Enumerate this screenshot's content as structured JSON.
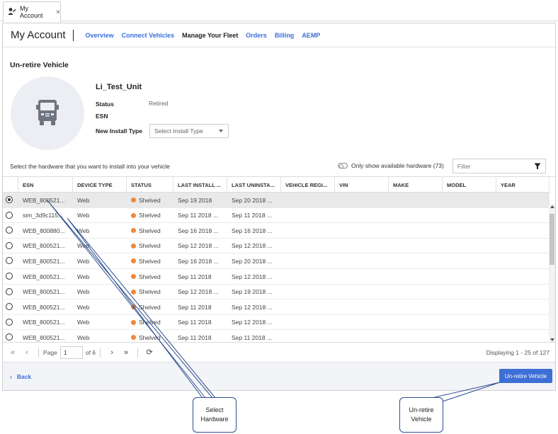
{
  "tab": {
    "label": "My Account"
  },
  "header": {
    "title": "My Account",
    "nav": [
      {
        "label": "Overview",
        "active": false
      },
      {
        "label": "Connect Vehicles",
        "active": false
      },
      {
        "label": "Manage Your Fleet",
        "active": true
      },
      {
        "label": "Orders",
        "active": false
      },
      {
        "label": "Billing",
        "active": false
      },
      {
        "label": "AEMP",
        "active": false
      }
    ]
  },
  "section": {
    "title": "Un-retire Vehicle"
  },
  "vehicle": {
    "name": "Li_Test_Unit",
    "status_label": "Status",
    "status_value": "Retired",
    "esn_label": "ESN",
    "install_type_label": "New Install Type",
    "install_type_placeholder": "Select Install Type"
  },
  "hardware": {
    "instruction": "Select the hardware that you want to install into your vehicle",
    "toggle_label": "Only show available hardware (73)",
    "filter_placeholder": "Filter",
    "columns": [
      "ESN",
      "DEVICE TYPE",
      "STATUS",
      "LAST INSTALL ...",
      "LAST UNINSTA...",
      "VEHICLE REGI...",
      "VIN",
      "MAKE",
      "MODEL",
      "YEAR"
    ],
    "rows": [
      {
        "esn": "WEB_800521...",
        "device": "Web",
        "status": "Shelved",
        "install": "Sep 19 2018",
        "uninstall": "Sep 20 2018 ...",
        "selected": true
      },
      {
        "esn": "sim_3d9c115...",
        "device": "Web",
        "status": "Shelved",
        "install": "Sep 11 2018 ...",
        "uninstall": "Sep 11 2018 ...",
        "selected": false
      },
      {
        "esn": "WEB_800880...",
        "device": "Web",
        "status": "Shelved",
        "install": "Sep 16 2018 ...",
        "uninstall": "Sep 16 2018 ...",
        "selected": false
      },
      {
        "esn": "WEB_800521...",
        "device": "Web",
        "status": "Shelved",
        "install": "Sep 12 2018 ...",
        "uninstall": "Sep 12 2018 ...",
        "selected": false
      },
      {
        "esn": "WEB_800521...",
        "device": "Web",
        "status": "Shelved",
        "install": "Sep 16 2018 ...",
        "uninstall": "Sep 20 2018 ...",
        "selected": false
      },
      {
        "esn": "WEB_800521...",
        "device": "Web",
        "status": "Shelved",
        "install": "Sep 11 2018",
        "uninstall": "Sep 12 2018 ...",
        "selected": false
      },
      {
        "esn": "WEB_800521...",
        "device": "Web",
        "status": "Shelved",
        "install": "Sep 12 2018 ...",
        "uninstall": "Sep 19 2018 ...",
        "selected": false
      },
      {
        "esn": "WEB_800521...",
        "device": "Web",
        "status": "Shelved",
        "install": "Sep 11 2018",
        "uninstall": "Sep 12 2018 ...",
        "selected": false
      },
      {
        "esn": "WEB_800521...",
        "device": "Web",
        "status": "Shelved",
        "install": "Sep 11 2018",
        "uninstall": "Sep 12 2018 ...",
        "selected": false
      },
      {
        "esn": "WEB_800521...",
        "device": "Web",
        "status": "Shelved",
        "install": "Sep 11 2018",
        "uninstall": "Sep 11 2018 ...",
        "selected": false
      }
    ]
  },
  "pager": {
    "page_label": "Page",
    "page_value": "1",
    "of_label": "of 6",
    "display_text": "Displaying 1 - 25 of 127"
  },
  "footer": {
    "back_label": "Back",
    "unretire_label": "Un-retire Vehicle"
  },
  "callouts": {
    "select_hardware": "Select Hardware",
    "unretire_vehicle": "Un-retire Vehicle"
  },
  "colors": {
    "accent": "#3a6fd8",
    "button": "#3d6fd6",
    "status_shelved": "#f0883a",
    "callout_border": "#2e4f8f"
  }
}
